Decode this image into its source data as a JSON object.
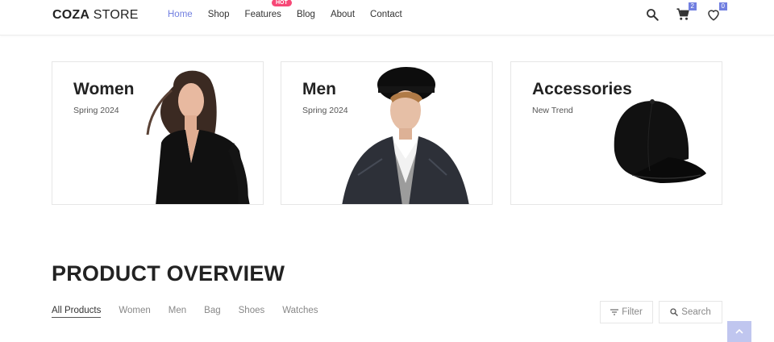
{
  "header": {
    "logo_bold": "COZA",
    "logo_light": "STORE",
    "nav": [
      {
        "label": "Home"
      },
      {
        "label": "Shop"
      },
      {
        "label": "Features"
      },
      {
        "label": "Blog"
      },
      {
        "label": "About"
      },
      {
        "label": "Contact"
      }
    ],
    "hot_label": "HOT",
    "cart_count": "2",
    "wishlist_count": "0",
    "accent_color": "#717fe0",
    "hot_color": "#f74877"
  },
  "banners": [
    {
      "title": "Women",
      "subtitle": "Spring 2024",
      "image": "woman-photo"
    },
    {
      "title": "Men",
      "subtitle": "Spring 2024",
      "image": "man-photo"
    },
    {
      "title": "Accessories",
      "subtitle": "New Trend",
      "image": "cap-photo"
    }
  ],
  "section": {
    "title": "PRODUCT OVERVIEW",
    "filters": [
      "All Products",
      "Women",
      "Men",
      "Bag",
      "Shoes",
      "Watches"
    ],
    "active_filter": "All Products",
    "filter_button": "Filter",
    "search_button": "Search"
  },
  "icons": [
    "search-icon",
    "cart-icon",
    "heart-icon",
    "filter-icon",
    "arrow-up-icon"
  ]
}
